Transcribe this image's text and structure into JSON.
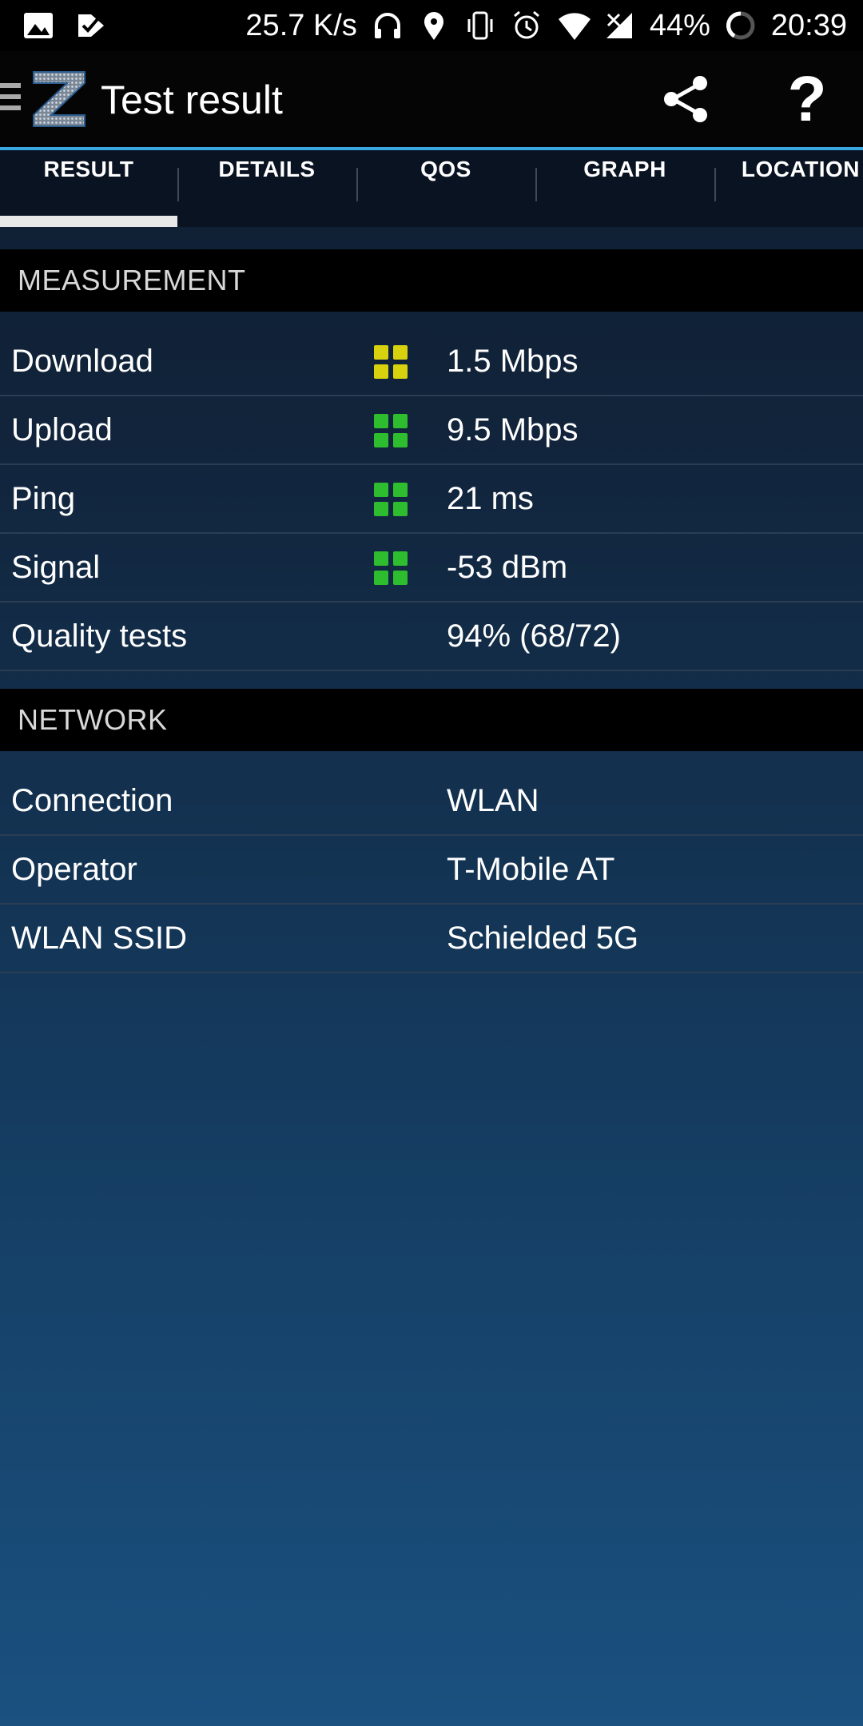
{
  "status_bar": {
    "speed": "25.7 K/s",
    "battery": "44%",
    "time": "20:39",
    "left_icons": [
      "image-icon",
      "checkmark-app-icon"
    ],
    "right_icons": [
      "headphones-icon",
      "location-icon",
      "vibrate-icon",
      "alarm-icon",
      "wifi-icon",
      "no-signal-icon",
      "battery-ring-icon"
    ]
  },
  "app_bar": {
    "title": "Test result",
    "help_label": "?"
  },
  "tabs": [
    {
      "label": "RESULT",
      "active": true
    },
    {
      "label": "DETAILS",
      "active": false
    },
    {
      "label": "QOS",
      "active": false
    },
    {
      "label": "GRAPH",
      "active": false
    },
    {
      "label": "LOCATION",
      "active": false
    }
  ],
  "measurement": {
    "header": "MEASUREMENT",
    "rows": [
      {
        "label": "Download",
        "value": "1.5 Mbps",
        "indicator": "yellow"
      },
      {
        "label": "Upload",
        "value": "9.5 Mbps",
        "indicator": "green"
      },
      {
        "label": "Ping",
        "value": "21 ms",
        "indicator": "green"
      },
      {
        "label": "Signal",
        "value": "-53 dBm",
        "indicator": "green"
      },
      {
        "label": "Quality tests",
        "value": "94% (68/72)",
        "indicator": "none"
      }
    ]
  },
  "network": {
    "header": "NETWORK",
    "rows": [
      {
        "label": "Connection",
        "value": "WLAN"
      },
      {
        "label": "Operator",
        "value": "T-Mobile AT"
      },
      {
        "label": "WLAN SSID",
        "value": "Schielded 5G"
      }
    ]
  },
  "colors": {
    "accent": "#3aa7e0",
    "indicator_yellow": "#d8d20e",
    "indicator_green": "#2ebd2e"
  }
}
